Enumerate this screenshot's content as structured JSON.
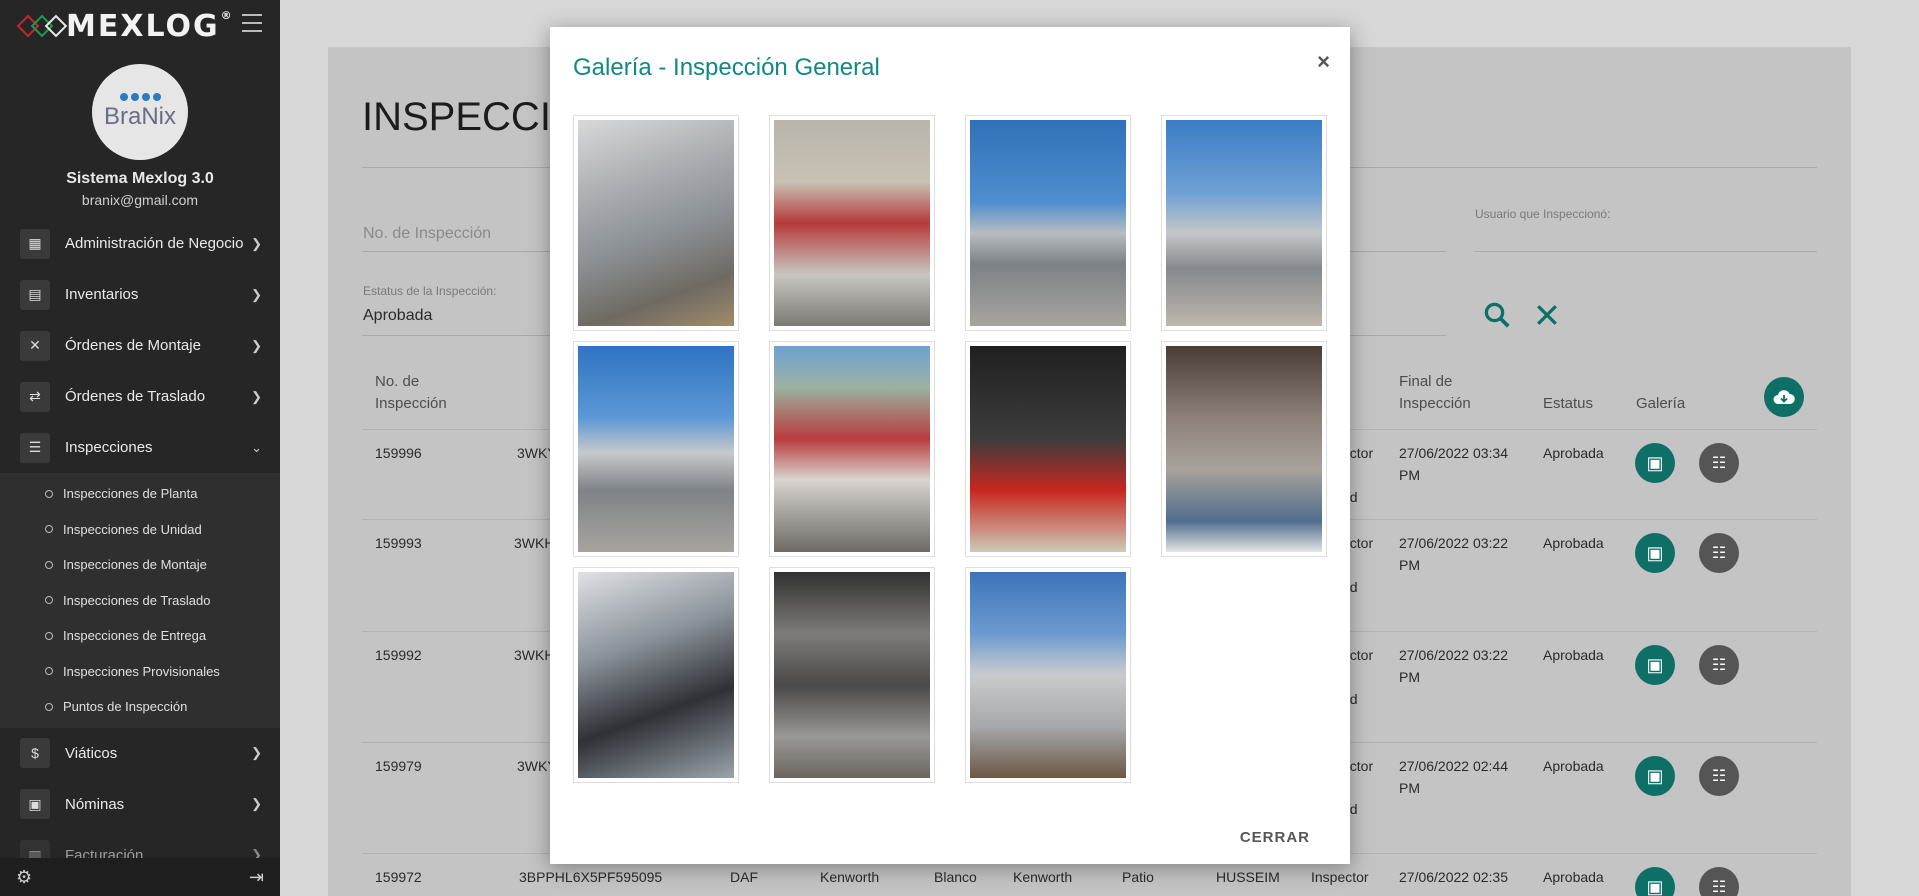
{
  "brand": {
    "name": "MEXLOG",
    "reg": "®"
  },
  "profile": {
    "avatar_text": "BraNix",
    "system": "Sistema Mexlog 3.0",
    "email": "branix@gmail.com"
  },
  "menu": [
    {
      "label": "Administración de Negocio",
      "icon": "building-icon"
    },
    {
      "label": "Inventarios",
      "icon": "clipboard-icon"
    },
    {
      "label": "Órdenes de Montaje",
      "icon": "tools-icon"
    },
    {
      "label": "Órdenes de Traslado",
      "icon": "transfer-icon"
    },
    {
      "label": "Inspecciones",
      "icon": "inspection-icon"
    }
  ],
  "submenu": [
    "Inspecciones de Planta",
    "Inspecciones de Unidad",
    "Inspecciones de Montaje",
    "Inspecciones de Traslado",
    "Inspecciones de Entrega",
    "Inspecciones Provisionales",
    "Puntos de Inspección"
  ],
  "menu2": [
    {
      "label": "Viáticos",
      "icon": "dollar-icon"
    },
    {
      "label": "Nóminas",
      "icon": "payroll-icon"
    },
    {
      "label": "Facturación",
      "icon": "invoice-icon"
    }
  ],
  "page": {
    "title": "INSPECCIO",
    "filter_no_placeholder": "No. de Inspección",
    "status_label": "Estatus de la Inspección:",
    "status_value": "Aprobada",
    "user_label": "Usuario que Inspeccionó:"
  },
  "table": {
    "headers": {
      "no1": "No. de",
      "no2": "Inspección",
      "final1": "Final de",
      "final2": "Inspección",
      "estatus": "Estatus",
      "galeria": "Galería"
    },
    "rows": [
      {
        "no": "159996",
        "vin": "3WKY",
        "insp1": "ector",
        "insp2": "ad",
        "final1": "27/06/2022 03:34",
        "final2": "PM",
        "status": "Aprobada"
      },
      {
        "no": "159993",
        "vin": "3WKH",
        "insp1": "ector",
        "insp2": "ad",
        "final1": "27/06/2022 03:22",
        "final2": "PM",
        "status": "Aprobada"
      },
      {
        "no": "159992",
        "vin": "3WKH",
        "insp1": "ector",
        "insp2": "ad",
        "final1": "27/06/2022 03:22",
        "final2": "PM",
        "status": "Aprobada"
      },
      {
        "no": "159979",
        "vin": "3WKY",
        "insp1": "ector",
        "insp2": "ad",
        "final1": "27/06/2022 02:44",
        "final2": "PM",
        "status": "Aprobada"
      }
    ],
    "last_row": {
      "no": "159972",
      "vin": "3BPPHL6X5PF595095",
      "brand": "DAF",
      "model": "Kenworth",
      "color": "Blanco",
      "client": "Kenworth",
      "location": "Patio",
      "user": "HUSSEIM",
      "role": "Inspector",
      "final": "27/06/2022 02:35",
      "status": "Aprobada"
    }
  },
  "modal": {
    "title": "Galería - Inspección General",
    "close": "×",
    "cerrar": "CERRAR",
    "photos": [
      "truck-rear-photo",
      "engine-bay-photo",
      "truck-front-photo",
      "truck-front-angle-photo",
      "truck-front-straight-photo",
      "fifth-wheel-photo",
      "tool-compartment-photo",
      "cargo-net-photo",
      "ignition-photo",
      "dashboard-gauges-photo",
      "cab-side-photo"
    ]
  },
  "colors": {
    "accent": "#0f8a80",
    "sidebar": "#262626",
    "dark_button": "#555555"
  }
}
